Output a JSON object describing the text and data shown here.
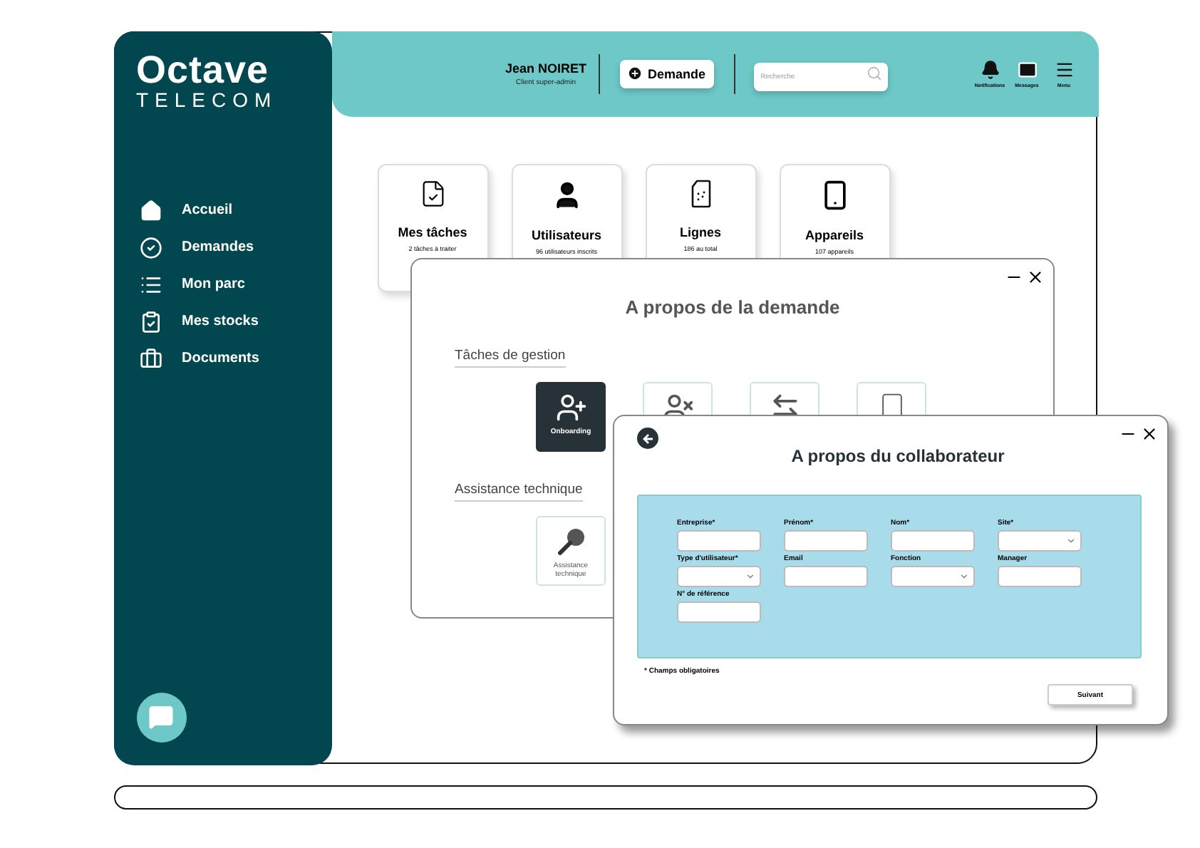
{
  "brand": {
    "name": "Octave",
    "sub": "TELECOM"
  },
  "sidebar": {
    "items": [
      {
        "label": "Accueil",
        "kind": "home"
      },
      {
        "label": "Demandes",
        "kind": "requests"
      },
      {
        "label": "Mon parc",
        "kind": "list"
      },
      {
        "label": "Mes stocks",
        "kind": "stock"
      },
      {
        "label": "Documents",
        "kind": "documents"
      }
    ]
  },
  "user": {
    "name": "Jean NOIRET",
    "role": "Client super-admin"
  },
  "new_request_button": "Demande",
  "search": {
    "placeholder": "Recherche"
  },
  "header_actions": [
    {
      "label": "Notifications",
      "kind": "bell"
    },
    {
      "label": "Messages",
      "kind": "mail"
    },
    {
      "label": "Menu",
      "kind": "menu"
    }
  ],
  "cards": [
    {
      "title": "Mes tâches",
      "subtitle": "2 tâches à traiter",
      "kind": "task"
    },
    {
      "title": "Utilisateurs",
      "subtitle": "96 utilisateurs inscrits",
      "kind": "user"
    },
    {
      "title": "Lignes",
      "subtitle": "186 au total",
      "kind": "sim"
    },
    {
      "title": "Appareils",
      "subtitle": "107 appareils",
      "kind": "device"
    }
  ],
  "request_dialog": {
    "title": "A propos de la demande",
    "sections": [
      {
        "heading": "Tâches de gestion",
        "tiles": [
          {
            "label": "Onboarding",
            "kind": "onboarding",
            "selected": true
          },
          {
            "kind": "offboarding",
            "selected": false
          },
          {
            "kind": "transfer",
            "selected": false
          },
          {
            "kind": "device",
            "selected": false
          }
        ]
      },
      {
        "heading": "Assistance technique",
        "tiles": [
          {
            "label": "Assistance technique",
            "kind": "support",
            "selected": false
          }
        ]
      }
    ]
  },
  "collaborator_dialog": {
    "title": "A propos du collaborateur",
    "fields": [
      {
        "label": "Entreprise*",
        "kind": "text"
      },
      {
        "label": "Prénom*",
        "kind": "text"
      },
      {
        "label": "Nom*",
        "kind": "text"
      },
      {
        "label": "Site*",
        "kind": "select"
      },
      {
        "label": "Type d'utilisateur*",
        "kind": "select"
      },
      {
        "label": "Email",
        "kind": "text"
      },
      {
        "label": "Fonction",
        "kind": "select"
      },
      {
        "label": "Manager",
        "kind": "text"
      },
      {
        "label": "N° de référence",
        "kind": "text"
      }
    ],
    "note": "* Champs obligatoires",
    "next_button": "Suivant"
  }
}
